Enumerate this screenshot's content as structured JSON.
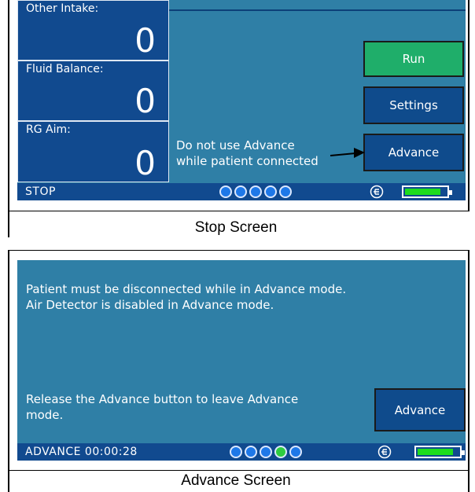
{
  "stop_screen": {
    "tiles": [
      {
        "label": "Other Intake:",
        "value": "0"
      },
      {
        "label": "Fluid Balance:",
        "value": "0"
      },
      {
        "label": "RG Aim:",
        "value": "0"
      }
    ],
    "warning_line1": "Do not use Advance",
    "warning_line2": "while patient connected",
    "buttons": {
      "run": "Run",
      "settings": "Settings",
      "advance": "Advance"
    },
    "status": "STOP",
    "caption": "Stop Screen"
  },
  "advance_screen": {
    "message_line1": "Patient must be disconnected while in Advance mode.",
    "message_line2": "Air Detector is disabled in Advance mode.",
    "release_line1": "Release the Advance button to leave Advance",
    "release_line2": "mode.",
    "buttons": {
      "advance": "Advance"
    },
    "status": "ADVANCE 00:00:28",
    "caption": "Advance Screen"
  },
  "colors": {
    "screen_bg": "#2f7fa6",
    "panel_blue": "#114a8f",
    "run_green": "#1fae6a",
    "battery_green": "#1edc1e",
    "active_dot": "#2ecc40"
  },
  "icons": [
    "bolus-icon",
    "battery-icon",
    "progress-dot-icon",
    "arrow-right-icon"
  ]
}
